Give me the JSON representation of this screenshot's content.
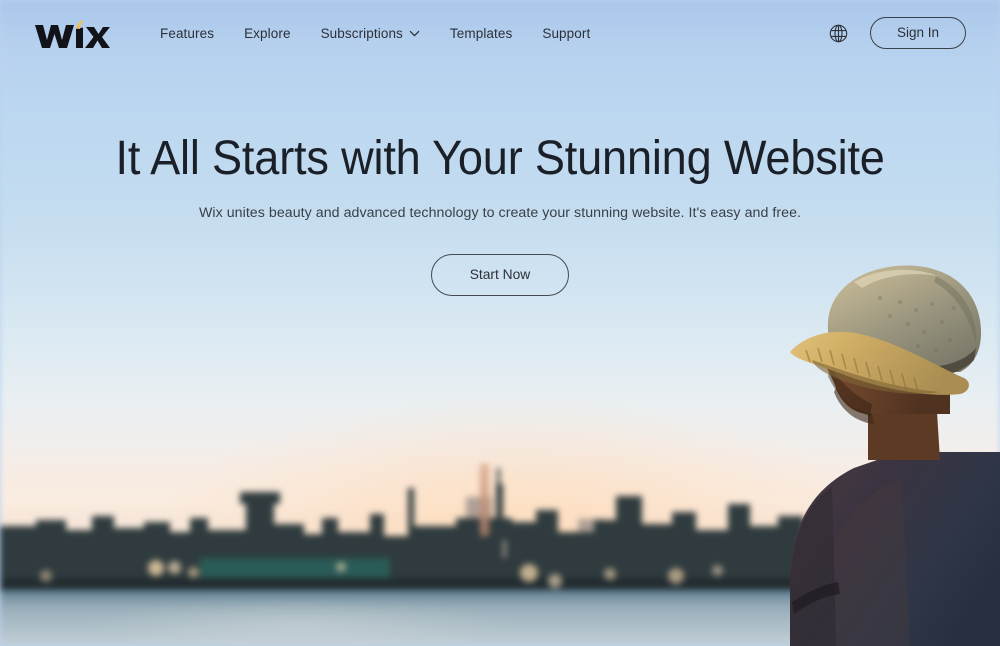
{
  "header": {
    "logo_text": "WiX",
    "logo_icon": "wix-logo",
    "nav": [
      {
        "label": "Features",
        "icon": null,
        "has_dropdown": false
      },
      {
        "label": "Explore",
        "icon": null,
        "has_dropdown": false
      },
      {
        "label": "Subscriptions",
        "icon": "chevron-down-icon",
        "has_dropdown": true
      },
      {
        "label": "Templates",
        "icon": null,
        "has_dropdown": false
      },
      {
        "label": "Support",
        "icon": null,
        "has_dropdown": false
      }
    ],
    "language_icon": "globe-icon",
    "sign_in_label": "Sign In"
  },
  "hero": {
    "headline": "It All Starts with Your Stunning Website",
    "subheadline": "Wix unites beauty and advanced technology to create your stunning website. It's easy and free.",
    "cta_label": "Start Now"
  },
  "background": {
    "description": "Blurred photograph of a man in a straw fedora hat looking out over a city skyline at sunset across water",
    "subject": "man-with-hat",
    "scene": "city-skyline-waterfront-sunset",
    "sky_top_color": "#a9c6ea",
    "sky_mid_color": "#c2dbf0",
    "horizon_color": "#f8ece3",
    "water_color": "#87a0ae",
    "skyline_color": "#2e3a3c"
  },
  "colors": {
    "text_primary": "#2c3039",
    "headline": "#1b2028",
    "button_border": "#454b53",
    "logo": "#111319",
    "logo_accent": "#f0c24b"
  }
}
